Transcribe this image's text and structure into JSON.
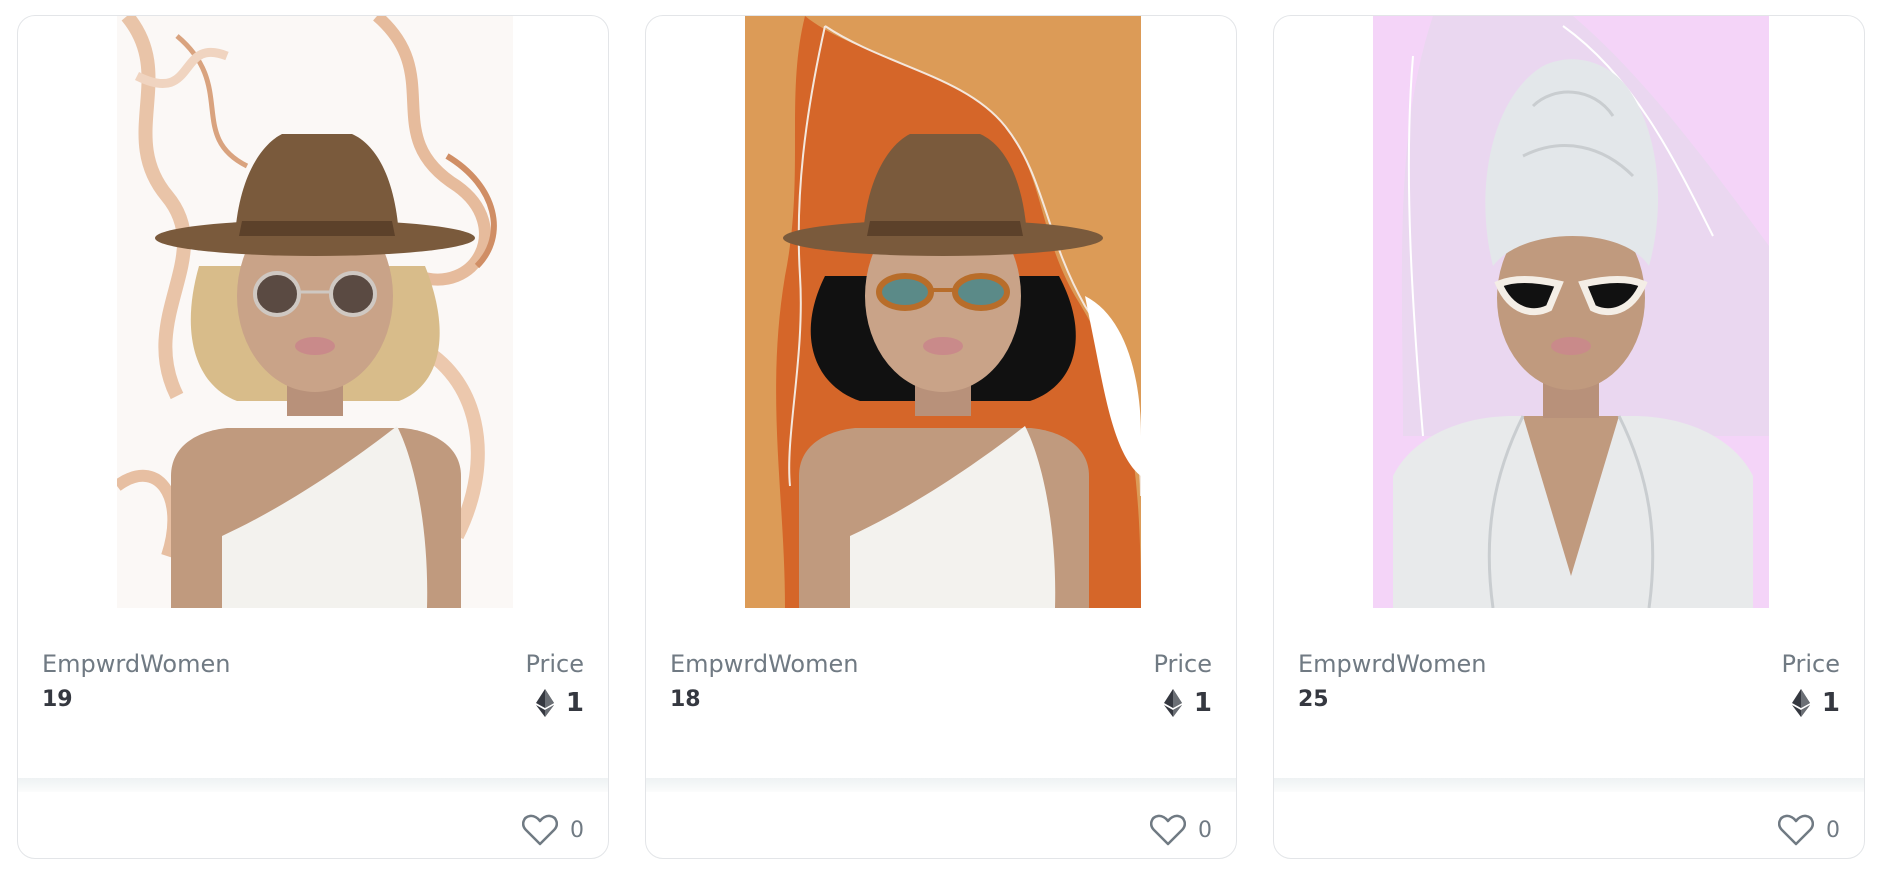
{
  "cards": [
    {
      "collection": "EmpwrdWomen",
      "token_id": "19",
      "price_label": "Price",
      "price": "1",
      "likes": "0",
      "image": "woman-in-hat-round-sunglasses",
      "background": "marble-swirl",
      "hair_color": "#d8bc8a"
    },
    {
      "collection": "EmpwrdWomen",
      "token_id": "18",
      "price_label": "Price",
      "price": "1",
      "likes": "0",
      "image": "woman-in-hat-tortoise-sunglasses",
      "background": "orange-wave",
      "hair_color": "#111111"
    },
    {
      "collection": "EmpwrdWomen",
      "token_id": "25",
      "price_label": "Price",
      "price": "1",
      "likes": "0",
      "image": "woman-in-towel-cat-eye-sunglasses",
      "background": "lilac",
      "hair_color": "#e3e7ea"
    }
  ],
  "icons": {
    "currency": "ethereum-icon",
    "like": "heart-icon"
  },
  "colors": {
    "text_primary": "#353840",
    "text_secondary": "#707a83",
    "card_border": "#e3e5e8",
    "skin": "#c09a7e",
    "hat": "#7a5a3c"
  }
}
